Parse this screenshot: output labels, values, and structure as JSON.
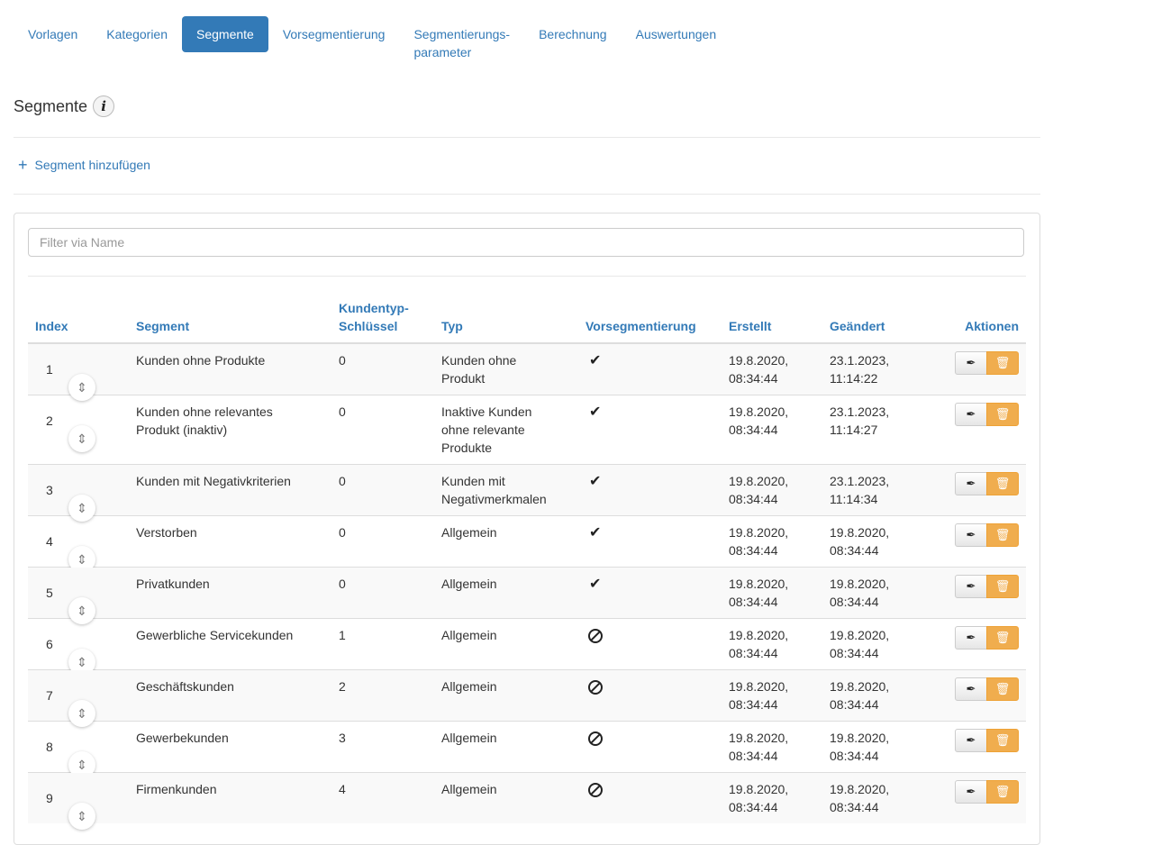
{
  "nav": {
    "tabs": [
      {
        "label": "Vorlagen",
        "active": false
      },
      {
        "label": "Kategorien",
        "active": false
      },
      {
        "label": "Segmente",
        "active": true
      },
      {
        "label": "Vorsegmentierung",
        "active": false
      },
      {
        "label": "Segmentierungs-\nparameter",
        "active": false
      },
      {
        "label": "Berechnung",
        "active": false
      },
      {
        "label": "Auswertungen",
        "active": false
      }
    ]
  },
  "page": {
    "title": "Segmente",
    "info_icon": "info-icon"
  },
  "add_segment": {
    "label": "Segment hinzufügen"
  },
  "filter": {
    "placeholder": "Filter via Name"
  },
  "table": {
    "headers": {
      "index": "Index",
      "segment": "Segment",
      "key": "Kundentyp-\nSchlüssel",
      "typ": "Typ",
      "vorseg": "Vorsegmentierung",
      "erstellt": "Erstellt",
      "geaendert": "Geändert",
      "aktionen": "Aktionen"
    },
    "rows": [
      {
        "index": "1",
        "segment": "Kunden ohne Produkte",
        "key": "0",
        "typ": "Kunden ohne\nProdukt",
        "vorseg": true,
        "erstellt": "19.8.2020,\n08:34:44",
        "geaendert": "23.1.2023,\n11:14:22"
      },
      {
        "index": "2",
        "segment": "Kunden ohne relevantes\nProdukt (inaktiv)",
        "key": "0",
        "typ": "Inaktive Kunden\nohne relevante\nProdukte",
        "vorseg": true,
        "erstellt": "19.8.2020,\n08:34:44",
        "geaendert": "23.1.2023,\n11:14:27"
      },
      {
        "index": "3",
        "segment": "Kunden mit Negativkriterien",
        "key": "0",
        "typ": "Kunden mit\nNegativmerkmalen",
        "vorseg": true,
        "erstellt": "19.8.2020,\n08:34:44",
        "geaendert": "23.1.2023,\n11:14:34"
      },
      {
        "index": "4",
        "segment": "Verstorben",
        "key": "0",
        "typ": "Allgemein",
        "vorseg": true,
        "erstellt": "19.8.2020,\n08:34:44",
        "geaendert": "19.8.2020,\n08:34:44"
      },
      {
        "index": "5",
        "segment": "Privatkunden",
        "key": "0",
        "typ": "Allgemein",
        "vorseg": true,
        "erstellt": "19.8.2020,\n08:34:44",
        "geaendert": "19.8.2020,\n08:34:44"
      },
      {
        "index": "6",
        "segment": "Gewerbliche Servicekunden",
        "key": "1",
        "typ": "Allgemein",
        "vorseg": false,
        "erstellt": "19.8.2020,\n08:34:44",
        "geaendert": "19.8.2020,\n08:34:44"
      },
      {
        "index": "7",
        "segment": "Geschäftskunden",
        "key": "2",
        "typ": "Allgemein",
        "vorseg": false,
        "erstellt": "19.8.2020,\n08:34:44",
        "geaendert": "19.8.2020,\n08:34:44"
      },
      {
        "index": "8",
        "segment": "Gewerbekunden",
        "key": "3",
        "typ": "Allgemein",
        "vorseg": false,
        "erstellt": "19.8.2020,\n08:34:44",
        "geaendert": "19.8.2020,\n08:34:44"
      },
      {
        "index": "9",
        "segment": "Firmenkunden",
        "key": "4",
        "typ": "Allgemein",
        "vorseg": false,
        "erstellt": "19.8.2020,\n08:34:44",
        "geaendert": "19.8.2020,\n08:34:44"
      }
    ]
  },
  "icons": {
    "edit": "edit-quill-icon",
    "delete": "trash-icon",
    "drag": "drag-reorder-icon",
    "yes": "checkmark-icon",
    "no": "ban-icon"
  }
}
